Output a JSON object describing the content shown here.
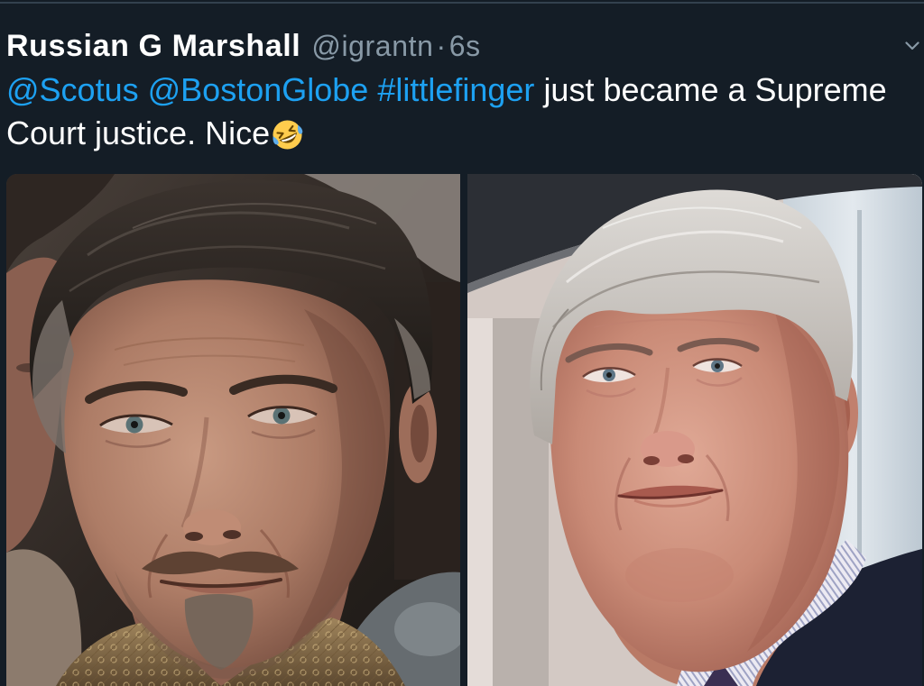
{
  "colors": {
    "background": "#141d26",
    "text": "#ffffff",
    "muted": "#8899a6",
    "link": "#1da1f2",
    "divider": "#33414e"
  },
  "tweet": {
    "author_name": "Russian G Marshall",
    "handle": "@igrantn",
    "separator": "·",
    "timestamp": "6s",
    "menu_icon": "chevron-down-icon",
    "mentions": [
      "@Scotus",
      "@BostonGlobe"
    ],
    "hashtag": "#littlefinger",
    "text_line1": "just became a Supreme",
    "text_line2": "Court justice. Nice",
    "emoji_icon": "rolling-on-the-floor-laughing-emoji-icon"
  }
}
